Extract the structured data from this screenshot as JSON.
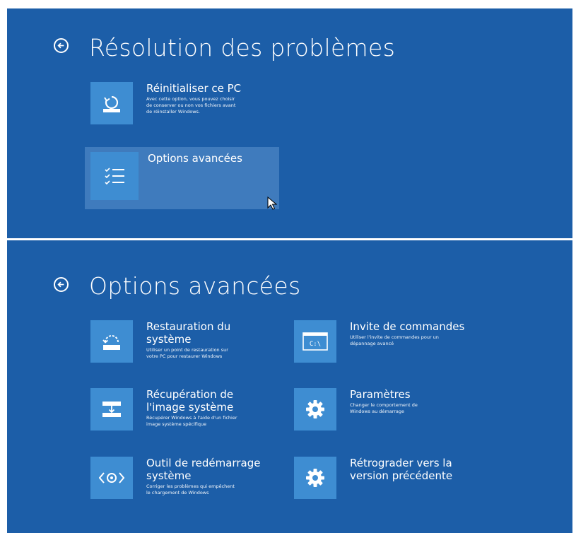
{
  "top_screen": {
    "title": "Résolution des problèmes",
    "tiles": [
      {
        "name": "Réinitialiser ce PC",
        "desc": [
          "Avec cette option, vous pouvez choisir",
          "de conserver ou non vos fichiers avant",
          "de réinstaller Windows."
        ],
        "icon": "reset-pc-icon"
      },
      {
        "name": "Options avancées",
        "desc": [],
        "icon": "checklist-icon"
      }
    ]
  },
  "bottom_screen": {
    "title": "Options avancées",
    "tiles": [
      {
        "name": "Restauration du système",
        "desc": [
          "Utiliser un point de restauration sur",
          "votre PC pour restaurer Windows"
        ],
        "icon": "system-restore-icon"
      },
      {
        "name": "Invite de commandes",
        "desc": [
          "Utiliser l'invite de commandes pour un",
          "dépannage avancé"
        ],
        "icon": "command-prompt-icon",
        "icon_text": "C:\\"
      },
      {
        "name": "Récupération de l'image système",
        "desc": [
          "Récupérer Windows à l'aide d'un fichier",
          "image système spécifique"
        ],
        "icon": "image-recovery-icon"
      },
      {
        "name": "Paramètres",
        "desc": [
          "Changer le comportement de",
          "Windows au démarrage"
        ],
        "icon": "gear-icon"
      },
      {
        "name": "Outil de redémarrage système",
        "desc": [
          "Corriger les problèmes qui empêchent",
          "le chargement de Windows"
        ],
        "icon": "startup-repair-icon"
      },
      {
        "name": "Rétrograder vers la version précédente",
        "desc": [],
        "icon": "gear-icon"
      }
    ]
  },
  "colors": {
    "background": "#1c5ea8",
    "tile_icon": "#3e8dd2",
    "highlight": "#3f7bbd",
    "text": "#ffffff"
  }
}
